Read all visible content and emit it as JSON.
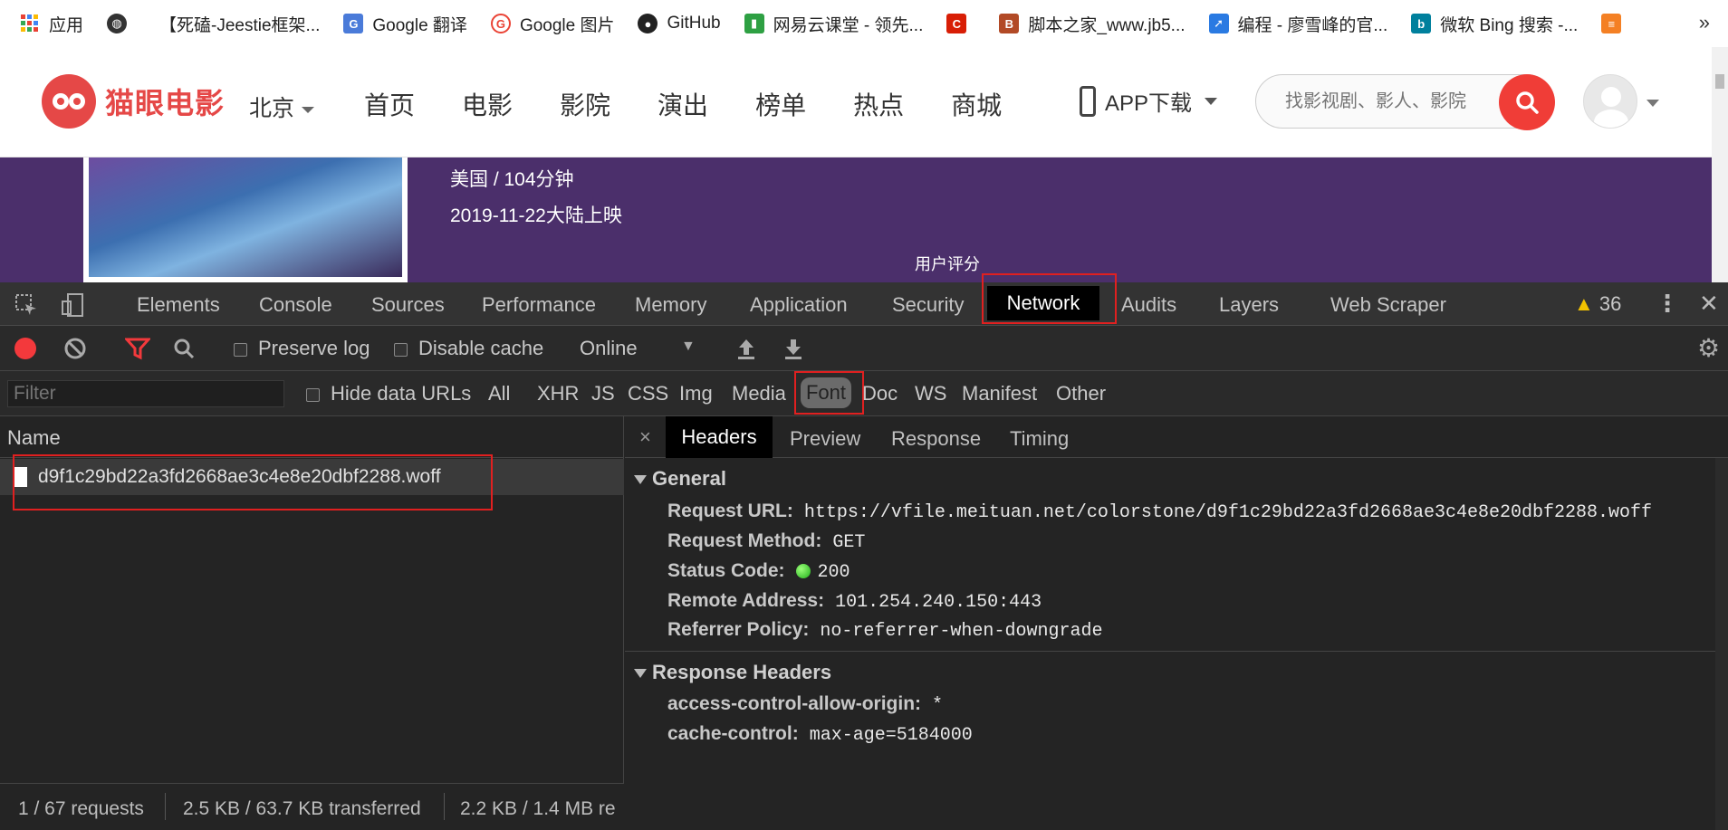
{
  "bookmarks": {
    "items": [
      {
        "label": "应用",
        "color": "#e94235"
      },
      {
        "label": "",
        "color": "#333333"
      },
      {
        "label": "【死磕-Jeestie框架...",
        "color": "#ffffff"
      },
      {
        "label": "Google 翻译",
        "color": "#4a7bd9"
      },
      {
        "label": "Google 图片",
        "color": "#ea4335"
      },
      {
        "label": "GitHub",
        "color": "#222222"
      },
      {
        "label": "网易云课堂 - 领先...",
        "color": "#2ea043"
      },
      {
        "label": "",
        "color": "#d81e06"
      },
      {
        "label": "脚本之家_www.jb5...",
        "color": "#b24a26"
      },
      {
        "label": "编程 - 廖雪峰的官...",
        "color": "#2a7ae2"
      },
      {
        "label": "微软 Bing 搜索 -...",
        "color": "#00809d"
      },
      {
        "label": "",
        "color": "#f48024"
      }
    ],
    "more": "»"
  },
  "site": {
    "logo": "猫眼电影",
    "city": "北京",
    "nav": [
      "首页",
      "电影",
      "影院",
      "演出",
      "榜单",
      "热点",
      "商城"
    ],
    "app_download": "APP下载",
    "search_placeholder": "找影视剧、影人、影院",
    "movie_meta1": "美国 / 104分钟",
    "movie_meta2": "2019-11-22大陆上映",
    "rating_label": "用户评分"
  },
  "devtools": {
    "tabs": [
      "Elements",
      "Console",
      "Sources",
      "Performance",
      "Memory",
      "Application",
      "Security",
      "Network",
      "Audits",
      "Layers",
      "Web Scraper"
    ],
    "warnings": "36",
    "toolbar": {
      "preserve_log": "Preserve log",
      "disable_cache": "Disable cache",
      "throttle": "Online"
    },
    "filter": {
      "placeholder": "Filter",
      "hide_data_urls": "Hide data URLs",
      "types": [
        "All",
        "XHR",
        "JS",
        "CSS",
        "Img",
        "Media",
        "Font",
        "Doc",
        "WS",
        "Manifest",
        "Other"
      ],
      "active_type": "Font"
    },
    "requests": {
      "column": "Name",
      "rows": [
        {
          "name": "d9f1c29bd22a3fd2668ae3c4e8e20dbf2288.woff"
        }
      ]
    },
    "status": {
      "requests": "1 / 67 requests",
      "transferred": "2.5 KB / 63.7 KB transferred",
      "resources": "2.2 KB / 1.4 MB re"
    },
    "detail": {
      "close": "×",
      "tabs": [
        "Headers",
        "Preview",
        "Response",
        "Timing"
      ],
      "general_title": "General",
      "general": [
        {
          "k": "Request URL:",
          "v": "https://vfile.meituan.net/colorstone/d9f1c29bd22a3fd2668ae3c4e8e20dbf2288.woff"
        },
        {
          "k": "Request Method:",
          "v": "GET"
        },
        {
          "k": "Status Code:",
          "v": "200"
        },
        {
          "k": "Remote Address:",
          "v": "101.254.240.150:443"
        },
        {
          "k": "Referrer Policy:",
          "v": "no-referrer-when-downgrade"
        }
      ],
      "response_title": "Response Headers",
      "response": [
        {
          "k": "access-control-allow-origin:",
          "v": "*"
        },
        {
          "k": "cache-control:",
          "v": "max-age=5184000"
        }
      ]
    }
  }
}
